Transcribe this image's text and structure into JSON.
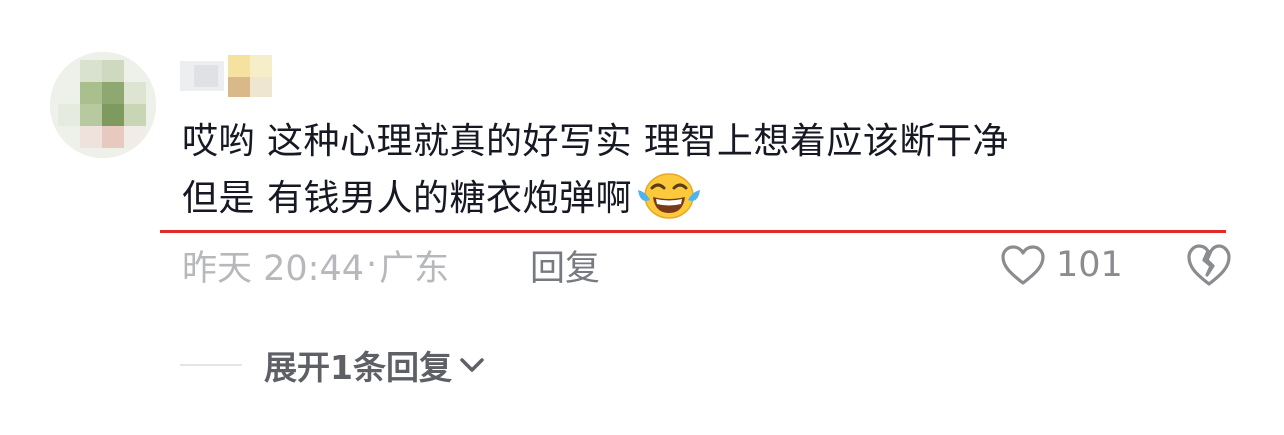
{
  "comment": {
    "text_line1": "哎哟 这种心理就真的好写实 理智上想着应该断干净",
    "text_line2": "但是 有钱男人的糖衣炮弹啊",
    "emoji": "laughing-with-tears-emoji",
    "timestamp": "昨天 20:44",
    "separator": "·",
    "location": "广东",
    "reply_label": "回复",
    "like_count": "101",
    "expand_label": "展开1条回复"
  },
  "icons": {
    "like": "heart-outline-icon",
    "dislike": "broken-heart-icon",
    "expand": "chevron-down-icon"
  },
  "colors": {
    "text": "#161823",
    "meta": "#b7b8bb",
    "reply": "#777a80",
    "underline": "#e02b26",
    "expand": "#5e6066"
  }
}
